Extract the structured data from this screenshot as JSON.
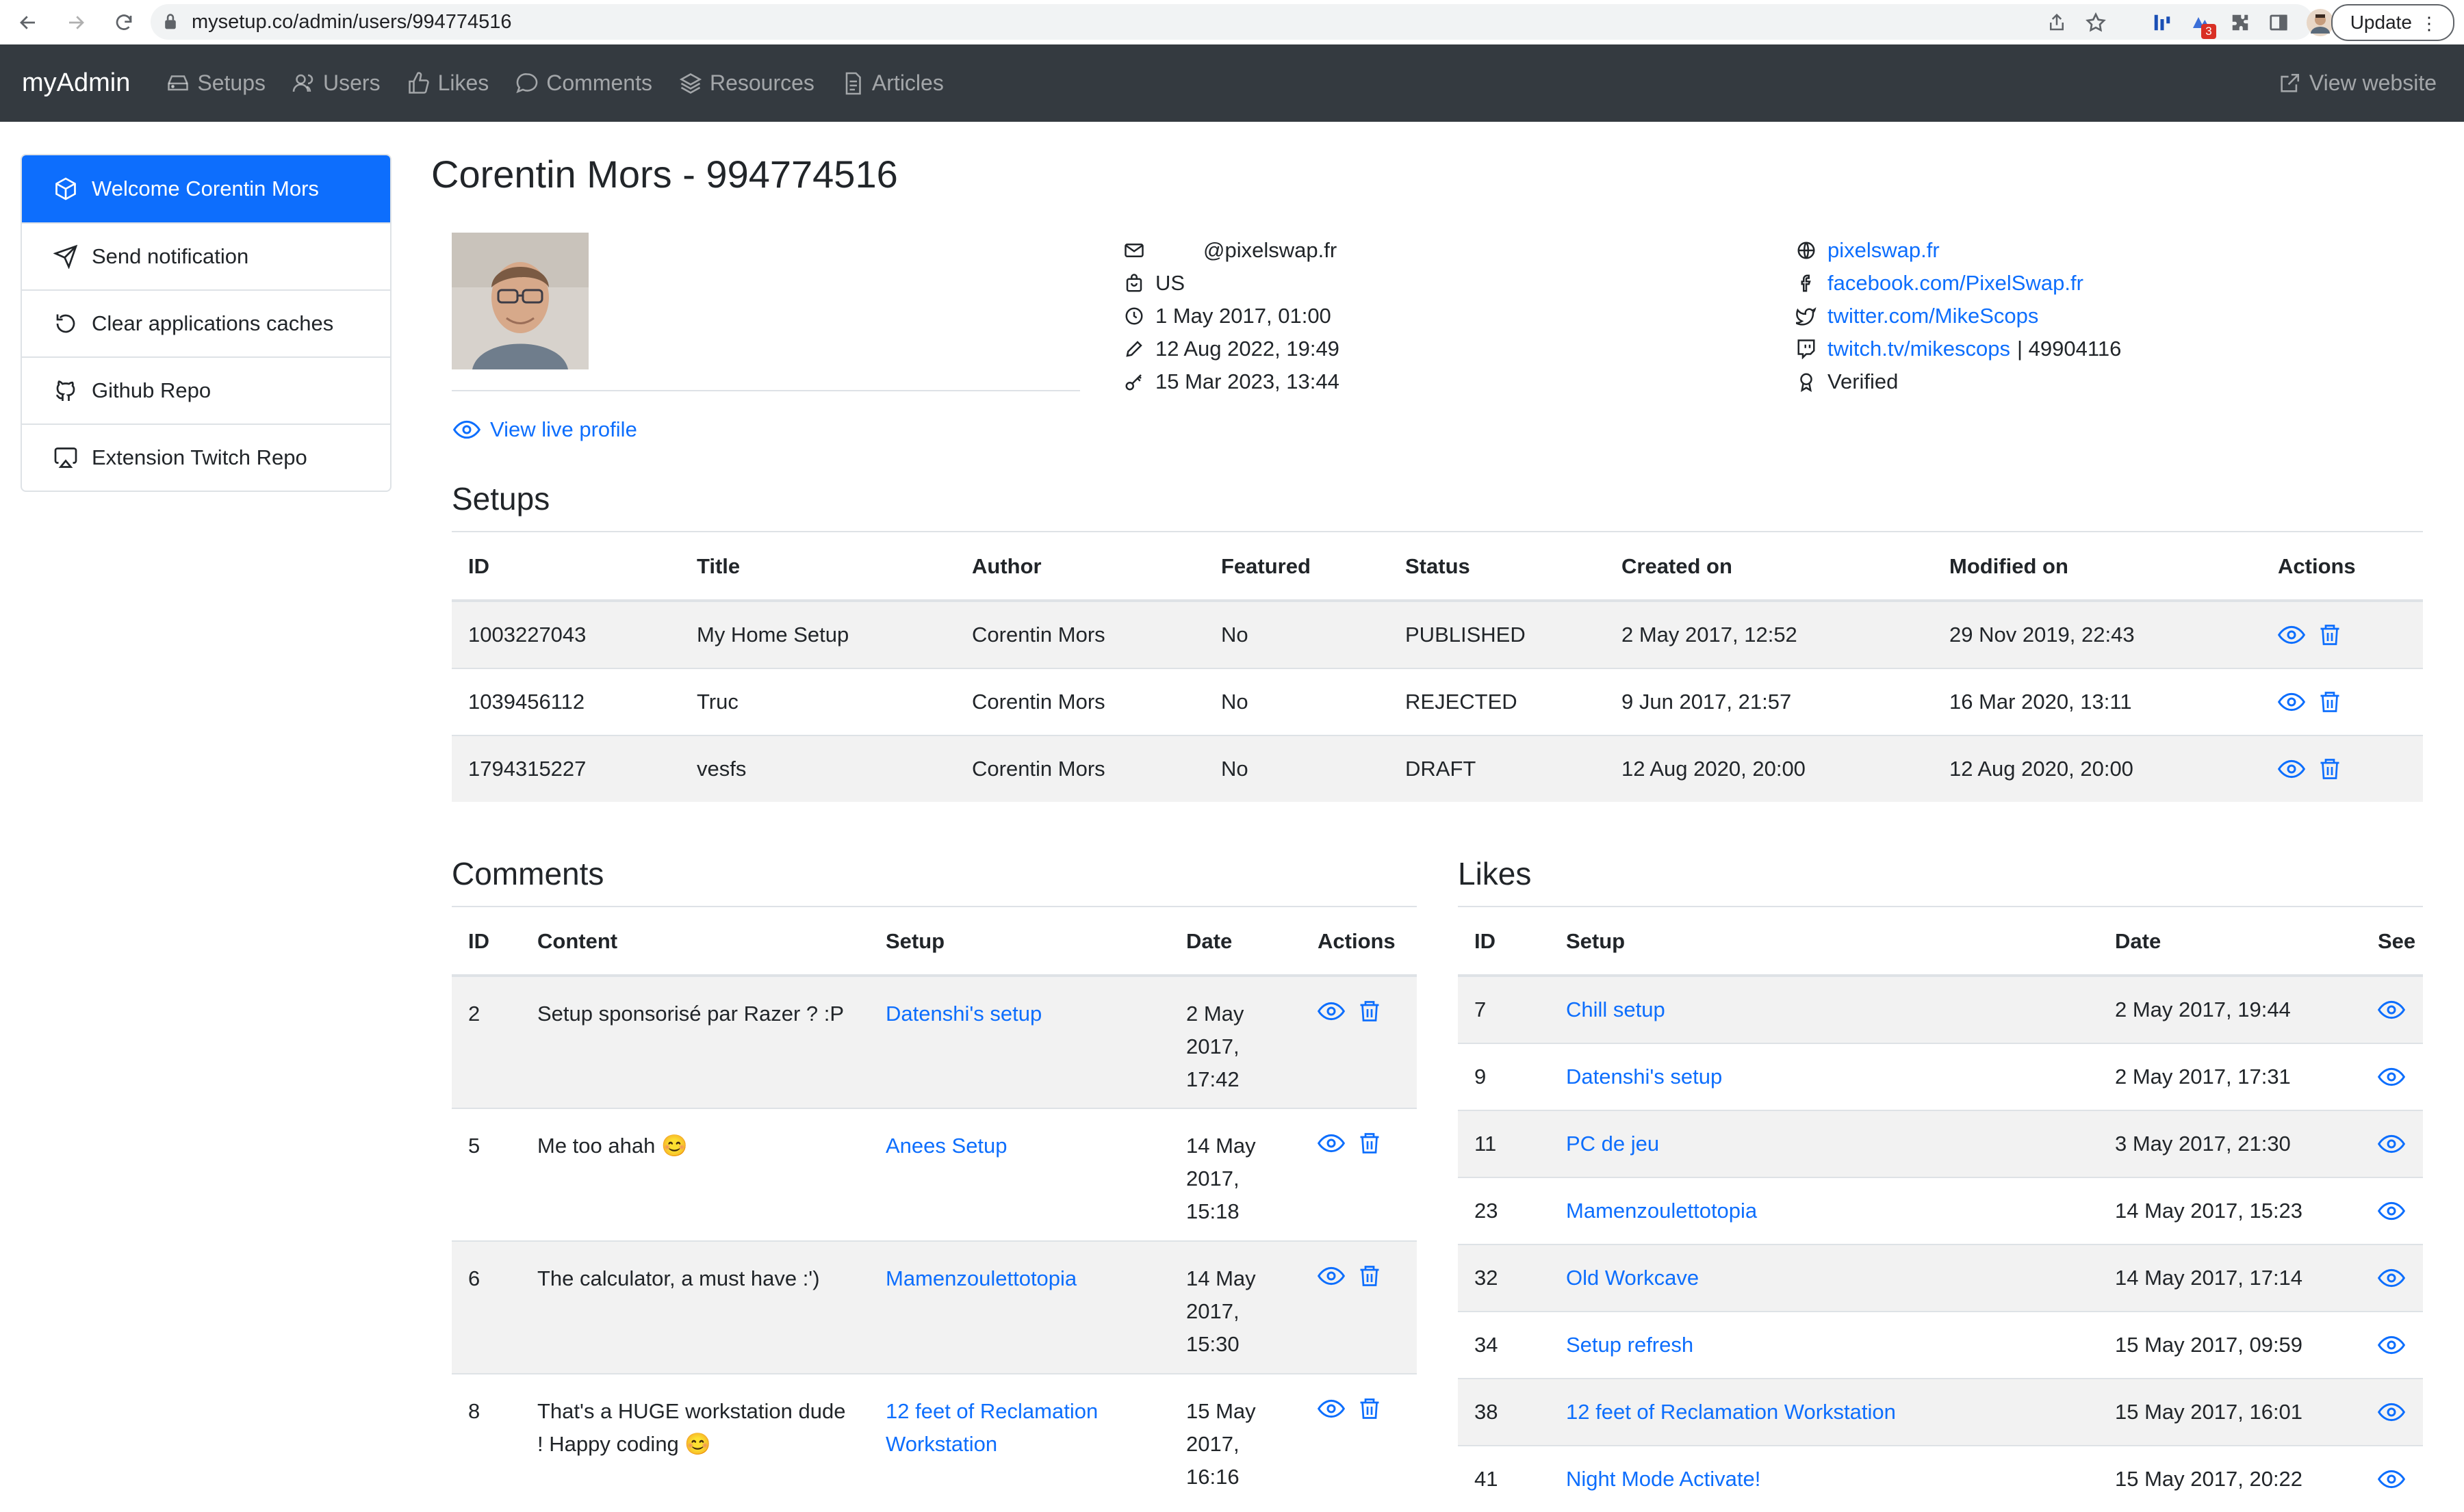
{
  "browser": {
    "url": "mysetup.co/admin/users/994774516",
    "update_label": "Update",
    "ext_badge": "3"
  },
  "navbar": {
    "brand": "myAdmin",
    "items": [
      {
        "label": "Setups",
        "icon": "drive-icon"
      },
      {
        "label": "Users",
        "icon": "users-icon"
      },
      {
        "label": "Likes",
        "icon": "thumbs-up-icon"
      },
      {
        "label": "Comments",
        "icon": "comment-icon"
      },
      {
        "label": "Resources",
        "icon": "layers-icon"
      },
      {
        "label": "Articles",
        "icon": "file-text-icon"
      }
    ],
    "view_website": "View website"
  },
  "sidebar": {
    "items": [
      {
        "label": "Welcome Corentin Mors",
        "icon": "box-icon"
      },
      {
        "label": "Send notification",
        "icon": "send-icon"
      },
      {
        "label": "Clear applications caches",
        "icon": "refresh-icon"
      },
      {
        "label": "Github Repo",
        "icon": "github-icon"
      },
      {
        "label": "Extension Twitch Repo",
        "icon": "airplay-icon"
      }
    ]
  },
  "user": {
    "title": "Corentin Mors - 994774516",
    "view_live_profile": "View live profile",
    "email": "@pixelswap.fr",
    "country": "US",
    "created": "1 May 2017, 01:00",
    "modified": "12 Aug 2022, 19:49",
    "last_login": "15 Mar 2023, 13:44",
    "website": "pixelswap.fr",
    "facebook": "facebook.com/PixelSwap.fr",
    "twitter": "twitter.com/MikeScops",
    "twitch": "twitch.tv/mikescops",
    "twitch_id": "| 49904116",
    "verified": "Verified"
  },
  "setups": {
    "heading": "Setups",
    "columns": [
      "ID",
      "Title",
      "Author",
      "Featured",
      "Status",
      "Created on",
      "Modified on",
      "Actions"
    ],
    "rows": [
      {
        "id": "1003227043",
        "title": "My Home Setup",
        "author": "Corentin Mors",
        "featured": "No",
        "status": "PUBLISHED",
        "created": "2 May 2017, 12:52",
        "modified": "29 Nov 2019, 22:43"
      },
      {
        "id": "1039456112",
        "title": "Truc",
        "author": "Corentin Mors",
        "featured": "No",
        "status": "REJECTED",
        "created": "9 Jun 2017, 21:57",
        "modified": "16 Mar 2020, 13:11"
      },
      {
        "id": "1794315227",
        "title": "vesfs",
        "author": "Corentin Mors",
        "featured": "No",
        "status": "DRAFT",
        "created": "12 Aug 2020, 20:00",
        "modified": "12 Aug 2020, 20:00"
      }
    ]
  },
  "comments": {
    "heading": "Comments",
    "columns": [
      "ID",
      "Content",
      "Setup",
      "Date",
      "Actions"
    ],
    "rows": [
      {
        "id": "2",
        "content": "Setup sponsorisé par Razer ? :P",
        "setup": "Datenshi's setup",
        "date": "2 May 2017, 17:42"
      },
      {
        "id": "5",
        "content": "Me too ahah 😊",
        "setup": "Anees Setup",
        "date": "14 May 2017, 15:18"
      },
      {
        "id": "6",
        "content": "The calculator, a must have :')",
        "setup": "Mamenzoulettotopia",
        "date": "14 May 2017, 15:30"
      },
      {
        "id": "8",
        "content": "That's a HUGE workstation dude ! Happy coding 😊",
        "setup": "12 feet of Reclamation Workstation",
        "date": "15 May 2017, 16:16"
      }
    ]
  },
  "likes": {
    "heading": "Likes",
    "columns": [
      "ID",
      "Setup",
      "Date",
      "See"
    ],
    "rows": [
      {
        "id": "7",
        "setup": "Chill setup",
        "date": "2 May 2017, 19:44"
      },
      {
        "id": "9",
        "setup": "Datenshi's setup",
        "date": "2 May 2017, 17:31"
      },
      {
        "id": "11",
        "setup": "PC de jeu",
        "date": "3 May 2017, 21:30"
      },
      {
        "id": "23",
        "setup": "Mamenzoulettotopia",
        "date": "14 May 2017, 15:23"
      },
      {
        "id": "32",
        "setup": "Old Workcave",
        "date": "14 May 2017, 17:14"
      },
      {
        "id": "34",
        "setup": "Setup refresh",
        "date": "15 May 2017, 09:59"
      },
      {
        "id": "38",
        "setup": "12 feet of Reclamation Workstation",
        "date": "15 May 2017, 16:01"
      },
      {
        "id": "41",
        "setup": "Night Mode Activate!",
        "date": "15 May 2017, 20:22"
      }
    ]
  },
  "colors": {
    "navbar_bg": "#343a40",
    "primary": "#0d6efd",
    "row_stripe": "#f2f2f2"
  }
}
